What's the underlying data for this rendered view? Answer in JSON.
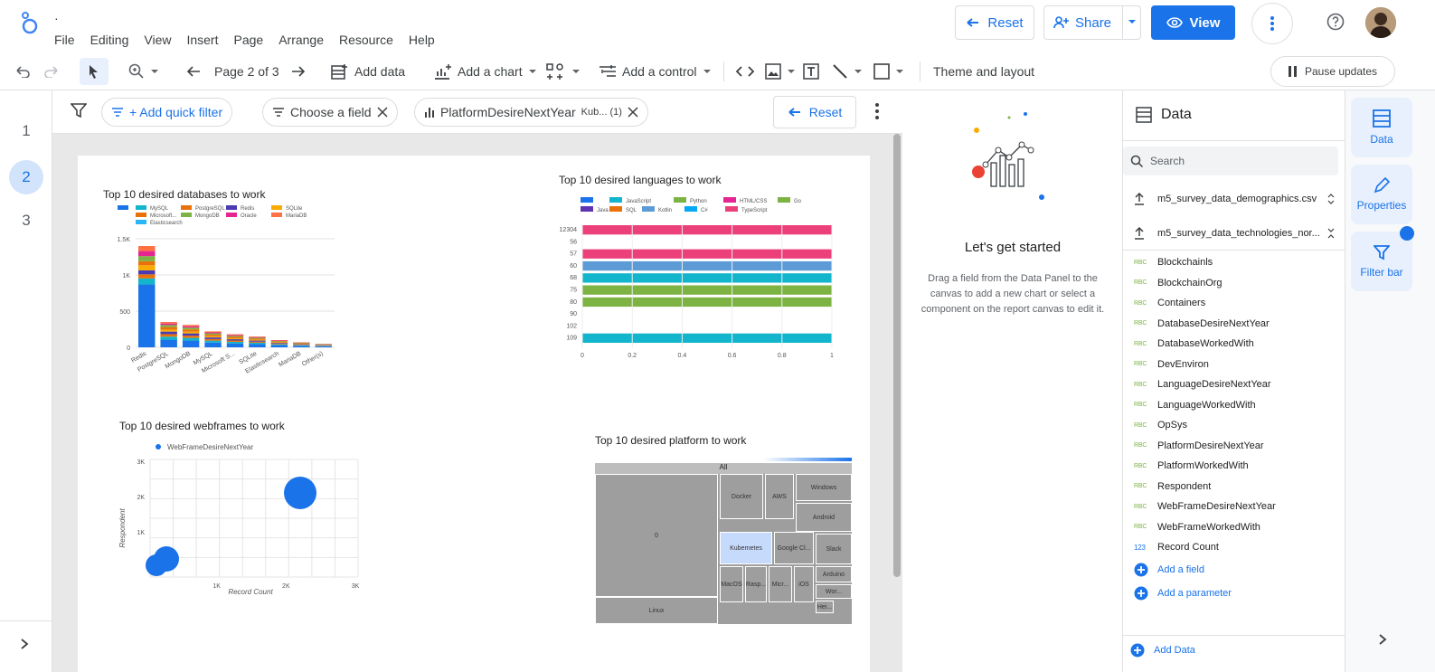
{
  "header": {
    "doc_title": "·",
    "menu": [
      "File",
      "Editing",
      "View",
      "Insert",
      "Page",
      "Arrange",
      "Resource",
      "Help"
    ],
    "reset_label": "Reset",
    "share_label": "Share",
    "view_label": "View"
  },
  "toolbar": {
    "page_indicator": "Page 2 of 3",
    "add_data": "Add data",
    "add_chart": "Add a chart",
    "add_control": "Add a control",
    "theme_layout": "Theme and layout",
    "pause_updates": "Pause updates"
  },
  "pages": [
    "1",
    "2",
    "3"
  ],
  "filterbar": {
    "add_quick_filter": "+ Add quick filter",
    "choose_field": "Choose a field",
    "platform_chip": "PlatformDesireNextYear",
    "platform_chip_suffix": "Kub... (1)",
    "reset_label": "Reset"
  },
  "charts": {
    "databases": {
      "title": "Top 10 desired databases to work",
      "legend": [
        "MySQL",
        "PostgreSQL",
        "Redis",
        "SQLite",
        "Microsoft...",
        "MongoDB",
        "Oracle",
        "MariaDB",
        "Elasticsearch"
      ],
      "yticks": [
        "1.5K",
        "1K",
        "500",
        "0"
      ],
      "categories": [
        "Redis",
        "PostgreSQL",
        "MongoDB",
        "MySQL",
        "Microsoft S...",
        "SQLite",
        "Elasticsearch",
        "MariaDB",
        "Other(s)"
      ],
      "totals": [
        1400,
        350,
        310,
        220,
        180,
        150,
        100,
        70,
        50
      ],
      "colors": [
        "#1a73e8",
        "#12b5cb",
        "#e8710a",
        "#4b3bb3",
        "#f9ab00",
        "#e8710a",
        "#7cb342",
        "#e52592",
        "#ff7043",
        "#29b6f6"
      ]
    },
    "languages": {
      "title": "Top 10 desired languages to work",
      "legend": [
        "",
        "JavaScript",
        "Python",
        "HTML/CSS",
        "Go",
        "Java",
        "SQL",
        "Kotlin",
        "C#",
        "TypeScript"
      ],
      "legend_colors": [
        "#1a73e8",
        "#12b5cb",
        "#7cb342",
        "#e52592",
        "#7cb342",
        "#5e35b1",
        "#e8710a",
        "#5c9bd5",
        "#03a9f4",
        "#ec407a"
      ],
      "categories": [
        "12304",
        "56",
        "57",
        "60",
        "68",
        "75",
        "80",
        "90",
        "102",
        "109"
      ],
      "bar_colors": [
        "#ec407a",
        "",
        "#ec407a",
        "#5c9bd5",
        "#12b5cb",
        "#7cb342",
        "#7cb342",
        "",
        "",
        "#12b5cb"
      ],
      "xticks": [
        "0",
        "0.2",
        "0.4",
        "0.6",
        "0.8",
        "1"
      ]
    },
    "webframes": {
      "title": "Top 10 desired webframes to work",
      "legend": "WebFrameDesireNextYear",
      "yticks": [
        "3K",
        "2K",
        "1K"
      ],
      "xticks": [
        "1K",
        "2K",
        "3K"
      ],
      "ylabel": "Respondent",
      "xlabel": "Record Count"
    },
    "platform": {
      "title": "Top 10 desired platform to work",
      "root": "All",
      "cells": [
        "0",
        "Linux",
        "Docker",
        "AWS",
        "Windows",
        "Android",
        "Kubernetes",
        "Google Cl...",
        "Slack",
        "Arduino",
        "MacOS",
        "Rasp...",
        "Micr...",
        "iOS",
        "Wor...",
        "Hei..."
      ]
    }
  },
  "started": {
    "title": "Let's get started",
    "body": "Drag a field from the Data Panel to the canvas to add a new chart or select a component on the report canvas to edit it."
  },
  "datapanel": {
    "title": "Data",
    "search_placeholder": "Search",
    "sources": [
      "m5_survey_data_demographics.csv",
      "m5_survey_data_technologies_nor..."
    ],
    "fields": [
      "Blockchainls",
      "BlockchainOrg",
      "Containers",
      "DatabaseDesireNextYear",
      "DatabaseWorkedWith",
      "DevEnviron",
      "LanguageDesireNextYear",
      "LanguageWorkedWith",
      "OpSys",
      "PlatformDesireNextYear",
      "PlatformWorkedWith",
      "Respondent",
      "WebFrameDesireNextYear",
      "WebFrameWorkedWith"
    ],
    "numeric_field": "Record Count",
    "add_field": "Add a field",
    "add_parameter": "Add a parameter",
    "add_data": "Add Data"
  },
  "rail": {
    "data": "Data",
    "properties": "Properties",
    "filterbar": "Filter bar"
  },
  "colors": {
    "accent": "#1a73e8",
    "rail_bg": "#e8f0fe",
    "canvas_bg": "#e8e8e8"
  }
}
